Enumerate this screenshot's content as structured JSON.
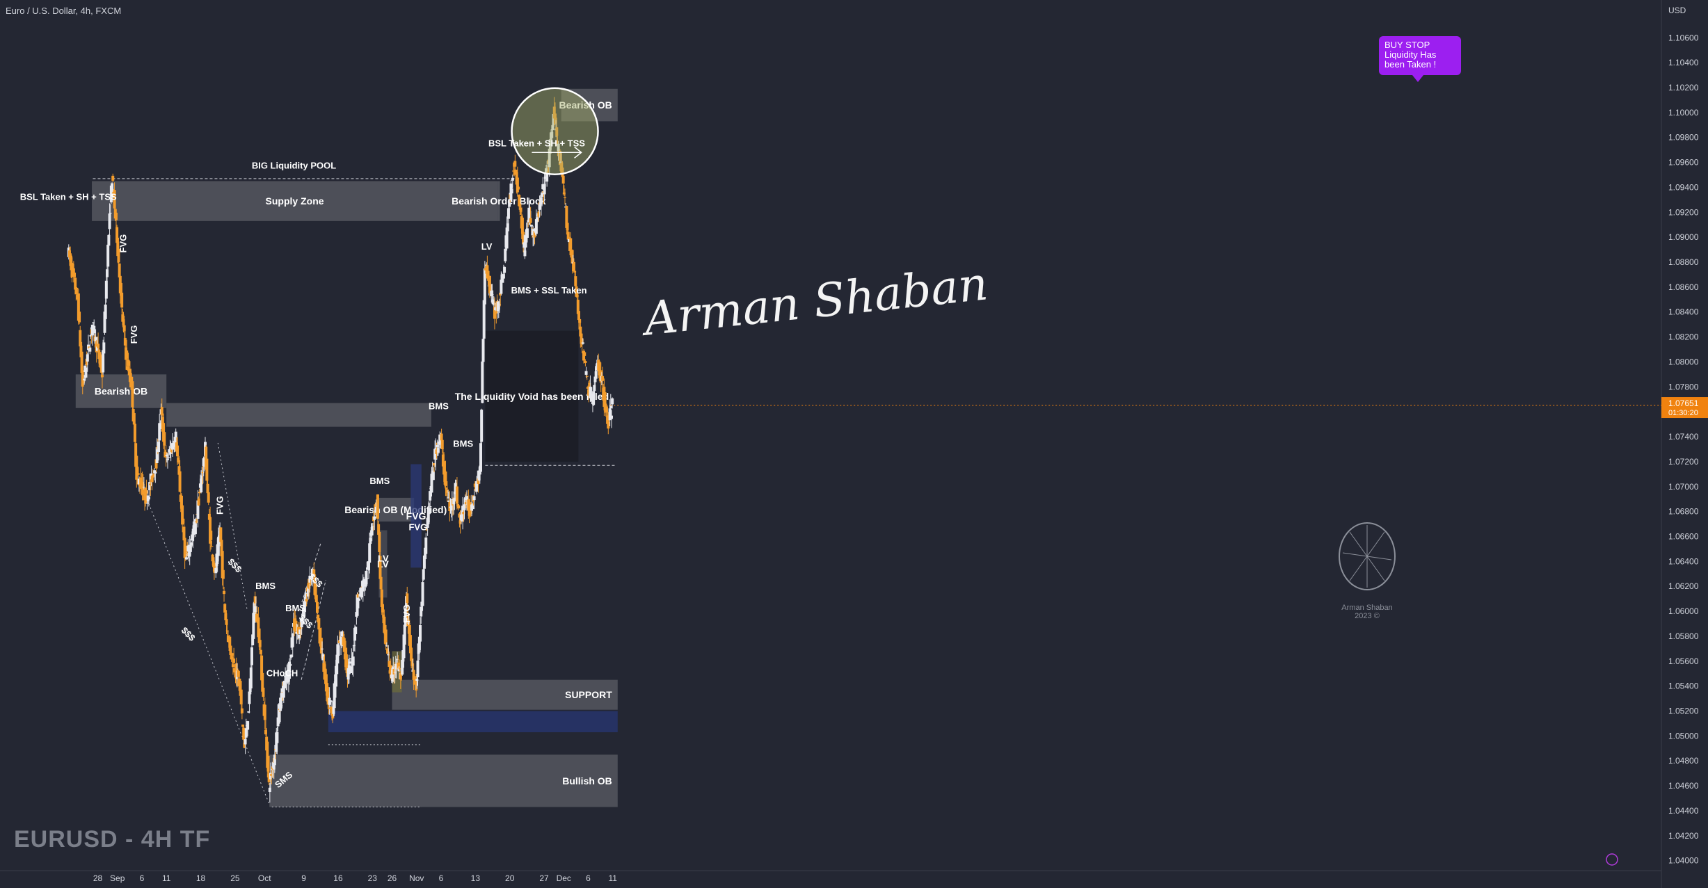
{
  "header": {
    "symbol_line": "Euro / U.S. Dollar, 4h, FXCM",
    "currency": "USD"
  },
  "watermark": "EURUSD - 4H TF",
  "signature": "Arman Shaban",
  "logo_caption": "Arman Shaban",
  "logo_year": "2023 ©",
  "callout": "BUY STOP Liquidity Has been Taken !",
  "price_tag": {
    "price": "1.07651",
    "countdown": "01:30:20"
  },
  "colors": {
    "bg": "#242733",
    "up": "#e8e9ee",
    "down": "#f39c2c",
    "zone": "#5b5e66",
    "support_blue": "#273774",
    "fvg_blue": "#2b3a78",
    "label_purple": "#9c1ff0",
    "price_tag": "#f0820f"
  },
  "chart_data": {
    "type": "candlestick",
    "title": "",
    "timeframe": "4h",
    "ylim": [
      1.0392,
      1.1078
    ],
    "y_ticks": [
      "1.10600",
      "1.10400",
      "1.10200",
      "1.10000",
      "1.09800",
      "1.09600",
      "1.09400",
      "1.09200",
      "1.09000",
      "1.08800",
      "1.08600",
      "1.08400",
      "1.08200",
      "1.08000",
      "1.07800",
      "1.07600",
      "1.07400",
      "1.07200",
      "1.07000",
      "1.06800",
      "1.06600",
      "1.06400",
      "1.06200",
      "1.06000",
      "1.05800",
      "1.05600",
      "1.05400",
      "1.05200",
      "1.05000",
      "1.04800",
      "1.04600",
      "1.04400",
      "1.04200",
      "1.04000"
    ],
    "x_ticks": [
      {
        "label": "28",
        "day": 0
      },
      {
        "label": "Sep",
        "day": 4
      },
      {
        "label": "6",
        "day": 9
      },
      {
        "label": "11",
        "day": 14
      },
      {
        "label": "18",
        "day": 21
      },
      {
        "label": "25",
        "day": 28
      },
      {
        "label": "Oct",
        "day": 34
      },
      {
        "label": "9",
        "day": 42
      },
      {
        "label": "16",
        "day": 49
      },
      {
        "label": "23",
        "day": 56
      },
      {
        "label": "26",
        "day": 60
      },
      {
        "label": "Nov",
        "day": 65
      },
      {
        "label": "6",
        "day": 70
      },
      {
        "label": "13",
        "day": 77
      },
      {
        "label": "20",
        "day": 84
      },
      {
        "label": "27",
        "day": 91
      },
      {
        "label": "Dec",
        "day": 95
      },
      {
        "label": "6",
        "day": 100
      },
      {
        "label": "11",
        "day": 105
      }
    ],
    "anchors": [
      {
        "day": -6,
        "price": 1.089
      },
      {
        "day": -4,
        "price": 1.085
      },
      {
        "day": -3,
        "price": 1.078
      },
      {
        "day": -1,
        "price": 1.083
      },
      {
        "day": 1,
        "price": 1.079
      },
      {
        "day": 2,
        "price": 1.088
      },
      {
        "day": 3,
        "price": 1.0948
      },
      {
        "day": 4,
        "price": 1.09
      },
      {
        "day": 5,
        "price": 1.084
      },
      {
        "day": 6,
        "price": 1.08
      },
      {
        "day": 7,
        "price": 1.078
      },
      {
        "day": 8,
        "price": 1.071
      },
      {
        "day": 10,
        "price": 1.069
      },
      {
        "day": 12,
        "price": 1.072
      },
      {
        "day": 13,
        "price": 1.076
      },
      {
        "day": 14,
        "price": 1.072
      },
      {
        "day": 16,
        "price": 1.074
      },
      {
        "day": 17,
        "price": 1.069
      },
      {
        "day": 18,
        "price": 1.064
      },
      {
        "day": 20,
        "price": 1.067
      },
      {
        "day": 21,
        "price": 1.07
      },
      {
        "day": 22,
        "price": 1.073
      },
      {
        "day": 23,
        "price": 1.066
      },
      {
        "day": 24,
        "price": 1.063
      },
      {
        "day": 25,
        "price": 1.0665
      },
      {
        "day": 26,
        "price": 1.06
      },
      {
        "day": 27,
        "price": 1.057
      },
      {
        "day": 29,
        "price": 1.054
      },
      {
        "day": 30,
        "price": 1.049
      },
      {
        "day": 31,
        "price": 1.053
      },
      {
        "day": 32,
        "price": 1.061
      },
      {
        "day": 33,
        "price": 1.058
      },
      {
        "day": 34,
        "price": 1.052
      },
      {
        "day": 35,
        "price": 1.046
      },
      {
        "day": 36,
        "price": 1.048
      },
      {
        "day": 37,
        "price": 1.052
      },
      {
        "day": 38,
        "price": 1.054
      },
      {
        "day": 39,
        "price": 1.055
      },
      {
        "day": 40,
        "price": 1.059
      },
      {
        "day": 41,
        "price": 1.058
      },
      {
        "day": 42,
        "price": 1.06
      },
      {
        "day": 43,
        "price": 1.062
      },
      {
        "day": 44,
        "price": 1.063
      },
      {
        "day": 45,
        "price": 1.059
      },
      {
        "day": 46,
        "price": 1.056
      },
      {
        "day": 47,
        "price": 1.053
      },
      {
        "day": 48,
        "price": 1.052
      },
      {
        "day": 49,
        "price": 1.057
      },
      {
        "day": 50,
        "price": 1.058
      },
      {
        "day": 51,
        "price": 1.055
      },
      {
        "day": 52,
        "price": 1.056
      },
      {
        "day": 53,
        "price": 1.061
      },
      {
        "day": 54,
        "price": 1.062
      },
      {
        "day": 55,
        "price": 1.063
      },
      {
        "day": 56,
        "price": 1.067
      },
      {
        "day": 57,
        "price": 1.069
      },
      {
        "day": 58,
        "price": 1.06
      },
      {
        "day": 59,
        "price": 1.057
      },
      {
        "day": 60,
        "price": 1.0545
      },
      {
        "day": 61,
        "price": 1.056
      },
      {
        "day": 62,
        "price": 1.0545
      },
      {
        "day": 63,
        "price": 1.061
      },
      {
        "day": 64,
        "price": 1.056
      },
      {
        "day": 65,
        "price": 1.054
      },
      {
        "day": 66,
        "price": 1.06
      },
      {
        "day": 67,
        "price": 1.066
      },
      {
        "day": 68,
        "price": 1.07
      },
      {
        "day": 69,
        "price": 1.073
      },
      {
        "day": 70,
        "price": 1.074
      },
      {
        "day": 71,
        "price": 1.07
      },
      {
        "day": 72,
        "price": 1.068
      },
      {
        "day": 73,
        "price": 1.07
      },
      {
        "day": 74,
        "price": 1.067
      },
      {
        "day": 75,
        "price": 1.069
      },
      {
        "day": 76,
        "price": 1.068
      },
      {
        "day": 77,
        "price": 1.07
      },
      {
        "day": 78,
        "price": 1.071
      },
      {
        "day": 79,
        "price": 1.088
      },
      {
        "day": 80,
        "price": 1.086
      },
      {
        "day": 81,
        "price": 1.084
      },
      {
        "day": 82,
        "price": 1.085
      },
      {
        "day": 83,
        "price": 1.088
      },
      {
        "day": 84,
        "price": 1.093
      },
      {
        "day": 85,
        "price": 1.096
      },
      {
        "day": 86,
        "price": 1.093
      },
      {
        "day": 87,
        "price": 1.089
      },
      {
        "day": 88,
        "price": 1.092
      },
      {
        "day": 89,
        "price": 1.09
      },
      {
        "day": 90,
        "price": 1.092
      },
      {
        "day": 91,
        "price": 1.094
      },
      {
        "day": 92,
        "price": 1.096
      },
      {
        "day": 93,
        "price": 1.1
      },
      {
        "day": 94,
        "price": 1.097
      },
      {
        "day": 95,
        "price": 1.094
      },
      {
        "day": 96,
        "price": 1.09
      },
      {
        "day": 97,
        "price": 1.088
      },
      {
        "day": 98,
        "price": 1.084
      },
      {
        "day": 99,
        "price": 1.081
      },
      {
        "day": 100,
        "price": 1.078
      },
      {
        "day": 101,
        "price": 1.077
      },
      {
        "day": 102,
        "price": 1.08
      },
      {
        "day": 103,
        "price": 1.078
      },
      {
        "day": 104,
        "price": 1.075
      },
      {
        "day": 105,
        "price": 1.0765
      }
    ],
    "zones": [
      {
        "label": "Supply Zone",
        "from": -1.2,
        "to": 81.5,
        "low": 1.0913,
        "high": 1.0945,
        "color": "#5b5e66"
      },
      {
        "label": "Bearish Order Block",
        "from": 81.5,
        "to": 82.0,
        "low": 1.0913,
        "high": 1.0945,
        "color": "#5b5e66"
      },
      {
        "label": "Bearish OB",
        "from": -4.5,
        "to": 14.0,
        "low": 1.0763,
        "high": 1.079,
        "color": "#5b5e66"
      },
      {
        "label": "",
        "from": 14.0,
        "to": 68.0,
        "low": 1.0748,
        "high": 1.0767,
        "color": "#5b5e66"
      },
      {
        "label": "Bearish OB",
        "from": 94.5,
        "to": 106.0,
        "low": 1.0993,
        "high": 1.1019,
        "color": "#5b5e66"
      },
      {
        "label": "Bearish OB (Modified)",
        "from": 57.0,
        "to": 64.5,
        "low": 1.0672,
        "high": 1.0691,
        "color": "#5b5e66"
      },
      {
        "label": "SUPPORT",
        "from": 60.0,
        "to": 106.0,
        "low": 1.0521,
        "high": 1.0545,
        "color": "#5b5e66"
      },
      {
        "label": "",
        "from": 47.0,
        "to": 106.0,
        "low": 1.0503,
        "high": 1.052,
        "color": "#273774"
      },
      {
        "label": "Bullish OB",
        "from": 35.0,
        "to": 106.0,
        "low": 1.0443,
        "high": 1.0485,
        "color": "#5b5e66"
      },
      {
        "label": "The Liquidity Void has been filled",
        "from": 79.0,
        "to": 98.0,
        "low": 1.072,
        "high": 1.0825,
        "color": "#1c1e26"
      },
      {
        "label": "FVG",
        "from": 63.8,
        "to": 66.0,
        "low": 1.0635,
        "high": 1.0718,
        "color": "#2b3a78"
      },
      {
        "label": "LV",
        "from": 57.3,
        "to": 59.0,
        "low": 1.0611,
        "high": 1.0665,
        "color": "#4d5059"
      },
      {
        "label": "",
        "from": 60.0,
        "to": 62.0,
        "low": 1.0535,
        "high": 1.0568,
        "color": "#6b6a3c"
      }
    ],
    "annotations": [
      {
        "text": "BIG Liquidity POOL",
        "day": 40,
        "price": 1.0955
      },
      {
        "text": "BSL Taken + SH + TSS",
        "day": -6,
        "price": 1.093
      },
      {
        "text": "FVG",
        "day": 5.8,
        "price": 1.0895
      },
      {
        "text": "FVG",
        "day": 8.0,
        "price": 1.0822
      },
      {
        "text": "FVG",
        "day": 25.5,
        "price": 1.0685
      },
      {
        "text": "$$$",
        "day": 18,
        "price": 1.058
      },
      {
        "text": "$$$",
        "day": 27.5,
        "price": 1.0635
      },
      {
        "text": "$$$",
        "day": 42,
        "price": 1.059
      },
      {
        "text": "$$$",
        "day": 44,
        "price": 1.0623
      },
      {
        "text": "BMS",
        "day": 34.2,
        "price": 1.0618
      },
      {
        "text": "BMS",
        "day": 40.3,
        "price": 1.06
      },
      {
        "text": "CHoCH",
        "day": 37.6,
        "price": 1.0548
      },
      {
        "text": "SMS",
        "day": 38.3,
        "price": 1.0463
      },
      {
        "text": "BMS",
        "day": 57.5,
        "price": 1.0702
      },
      {
        "text": "LV",
        "day": 58.2,
        "price": 1.064
      },
      {
        "text": "FVG",
        "day": 63.6,
        "price": 1.0598
      },
      {
        "text": "FVG",
        "day": 65.3,
        "price": 1.0665
      },
      {
        "text": "BMS",
        "day": 69.5,
        "price": 1.0762
      },
      {
        "text": "BMS",
        "day": 74.5,
        "price": 1.0732
      },
      {
        "text": "LV",
        "day": 79.3,
        "price": 1.089
      },
      {
        "text": "BSL Taken + SH + TSS",
        "day": 89.5,
        "price": 1.0973
      },
      {
        "text": "BMS + SSL Taken",
        "day": 92,
        "price": 1.0855
      }
    ]
  }
}
